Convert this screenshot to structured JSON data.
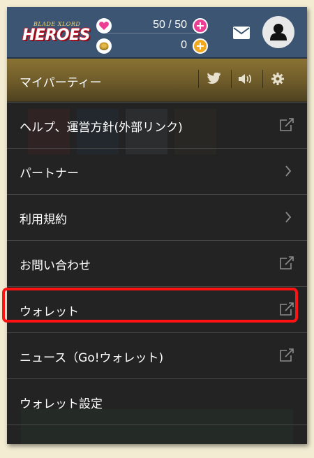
{
  "header": {
    "logo_small": "BLADE XLORD",
    "logo_main": "HEROES",
    "stamina": {
      "current": 50,
      "max": 50,
      "text": "50 / 50"
    },
    "coins": {
      "text": "0"
    },
    "colors": {
      "header_bg": "#3b5573",
      "plus_pink": "#ec3f94",
      "plus_orange": "#f2a91e",
      "heart": "#ec3f94"
    }
  },
  "party_bar": {
    "title": "マイパーティー",
    "icons": [
      "twitter-icon",
      "speaker-icon",
      "gear-icon"
    ]
  },
  "menu": {
    "items": [
      {
        "label": "ヘルプ、運営方針(外部リンク)",
        "icon": "external-link-icon"
      },
      {
        "label": "パートナー",
        "icon": "chevron-right-icon"
      },
      {
        "label": "利用規約",
        "icon": "chevron-right-icon"
      },
      {
        "label": "お問い合わせ",
        "icon": "external-link-icon"
      },
      {
        "label": "ウォレット",
        "icon": "external-link-icon",
        "highlighted": true
      },
      {
        "label": "ニュース（Go!ウォレット)",
        "icon": "external-link-icon"
      },
      {
        "label": "ウォレット設定",
        "icon": ""
      }
    ],
    "highlight_color": "#ff1212"
  }
}
